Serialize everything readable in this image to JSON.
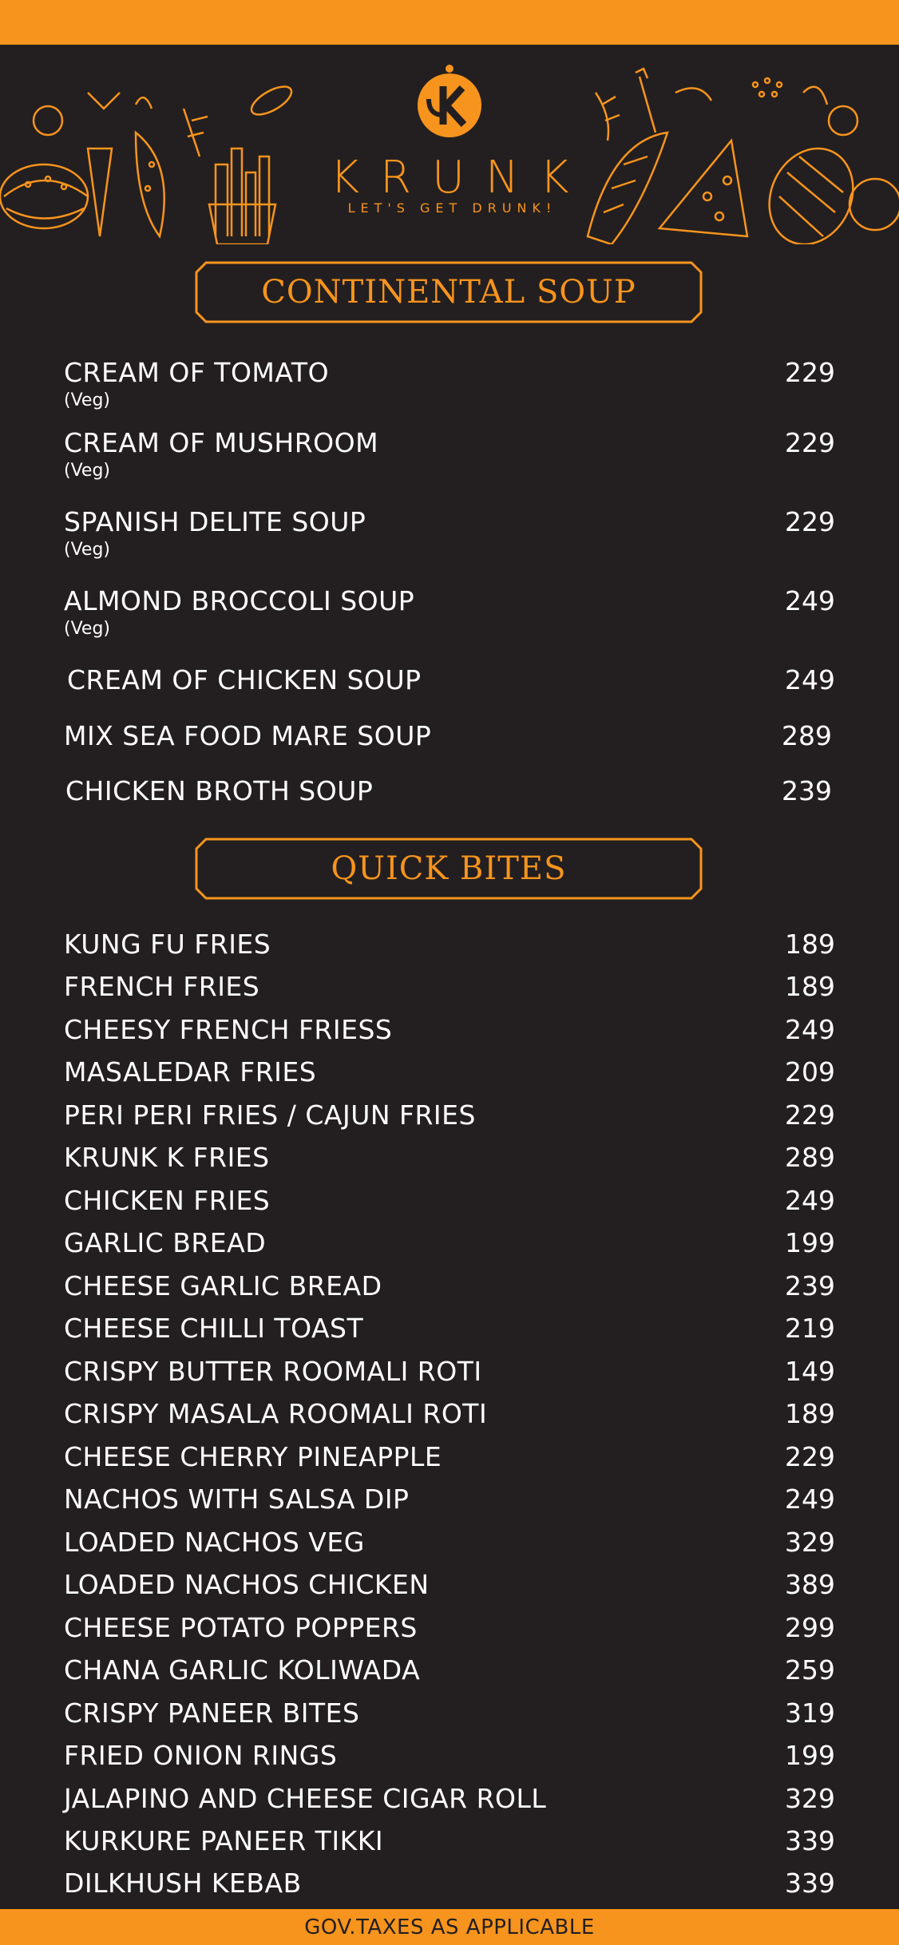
{
  "brand": {
    "name": "KRUNK",
    "tagline": "LET'S GET DRUNK!"
  },
  "colors": {
    "accent": "#f7941d",
    "background": "#231f20",
    "text": "#ffffff"
  },
  "sections": [
    {
      "title": "CONTINENTAL SOUP",
      "items": [
        {
          "name": "CREAM OF TOMATO",
          "note": "(Veg)",
          "price": "229"
        },
        {
          "name": "CREAM OF MUSHROOM",
          "note": "(Veg)",
          "price": "229"
        },
        {
          "name": "SPANISH DELITE SOUP",
          "note": "(Veg)",
          "price": "229"
        },
        {
          "name": "ALMOND BROCCOLI SOUP",
          "note": "(Veg)",
          "price": "249"
        },
        {
          "name": "CREAM OF CHICKEN SOUP",
          "price": "249"
        },
        {
          "name": "MIX SEA FOOD MARE SOUP",
          "price": "289"
        },
        {
          "name": "CHICKEN BROTH SOUP",
          "price": "239"
        }
      ]
    },
    {
      "title": "QUICK BITES",
      "items": [
        {
          "name": "KUNG FU FRIES",
          "price": "189"
        },
        {
          "name": "FRENCH FRIES",
          "price": "189"
        },
        {
          "name": "CHEESY FRENCH FRIESS",
          "price": "249"
        },
        {
          "name": "MASALEDAR FRIES",
          "price": "209"
        },
        {
          "name": "PERI PERI FRIES / CAJUN FRIES",
          "price": "229"
        },
        {
          "name": "KRUNK K FRIES",
          "price": "289"
        },
        {
          "name": "CHICKEN FRIES",
          "price": "249"
        },
        {
          "name": "GARLIC BREAD",
          "price": "199"
        },
        {
          "name": "CHEESE GARLIC BREAD",
          "price": "239"
        },
        {
          "name": "CHEESE CHILLI TOAST",
          "price": "219"
        },
        {
          "name": "CRISPY BUTTER ROOMALI ROTI",
          "price": "149"
        },
        {
          "name": "CRISPY MASALA ROOMALI ROTI",
          "price": "189"
        },
        {
          "name": "CHEESE CHERRY PINEAPPLE",
          "price": "229"
        },
        {
          "name": "NACHOS WITH SALSA DIP",
          "price": "249"
        },
        {
          "name": "LOADED NACHOS VEG",
          "price": "329"
        },
        {
          "name": "LOADED NACHOS CHICKEN",
          "price": "389"
        },
        {
          "name": "CHEESE POTATO POPPERS",
          "price": "299"
        },
        {
          "name": "CHANA GARLIC KOLIWADA",
          "price": "259"
        },
        {
          "name": "CRISPY PANEER BITES",
          "price": "319"
        },
        {
          "name": "FRIED ONION RINGS",
          "price": "199"
        },
        {
          "name": "JALAPINO AND CHEESE CIGAR ROLL",
          "price": "329"
        },
        {
          "name": "KURKURE PANEER TIKKI",
          "price": "339"
        },
        {
          "name": "DILKHUSH KEBAB",
          "price": "339"
        }
      ]
    }
  ],
  "footer": {
    "text": "GOV.TAXES AS APPLICABLE"
  }
}
